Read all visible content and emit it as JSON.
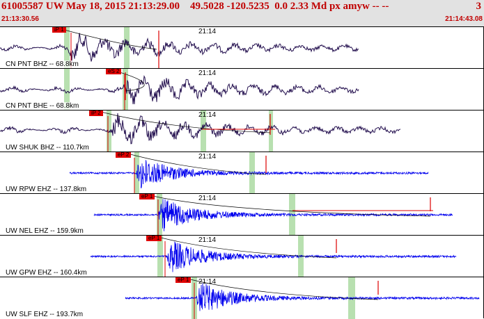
{
  "header": {
    "title": "61005587 UW May 18, 2015 21:13:29.00    49.5028 -120.5235  0.0 2.33 Md px amyw -- --",
    "count": "3",
    "time_start": "21:13:30.56",
    "time_end": "21:14:43.08"
  },
  "tracks": [
    {
      "label": "CN PNT BHZ -- 68.8km",
      "time_label": "21:14",
      "pick": "iP 1",
      "color": "#24104f",
      "broadband": true
    },
    {
      "label": "CN PNT BHE -- 68.8km",
      "time_label": "21:14",
      "pick": "eS 2",
      "color": "#24104f",
      "broadband": true
    },
    {
      "label": "UW SHUK BHZ -- 110.7km",
      "time_label": "21:14",
      "pick": "iP 2",
      "color": "#24104f",
      "broadband": true
    },
    {
      "label": "UW RPW EHZ -- 137.8km",
      "time_label": "21:14",
      "pick": "eP 2",
      "color": "#0000ee",
      "broadband": false
    },
    {
      "label": "UW NEL EHZ -- 159.9km",
      "time_label": "21:14",
      "pick": "eP 1",
      "color": "#0000ee",
      "broadband": false
    },
    {
      "label": "UW GPW EHZ -- 160.4km",
      "time_label": "21:14",
      "pick": "eP 1",
      "color": "#0000ee",
      "broadband": false
    },
    {
      "label": "UW SLF EHZ -- 193.7km",
      "time_label": "21:14",
      "pick": "eP 1",
      "color": "#0000ee",
      "broadband": false
    }
  ]
}
